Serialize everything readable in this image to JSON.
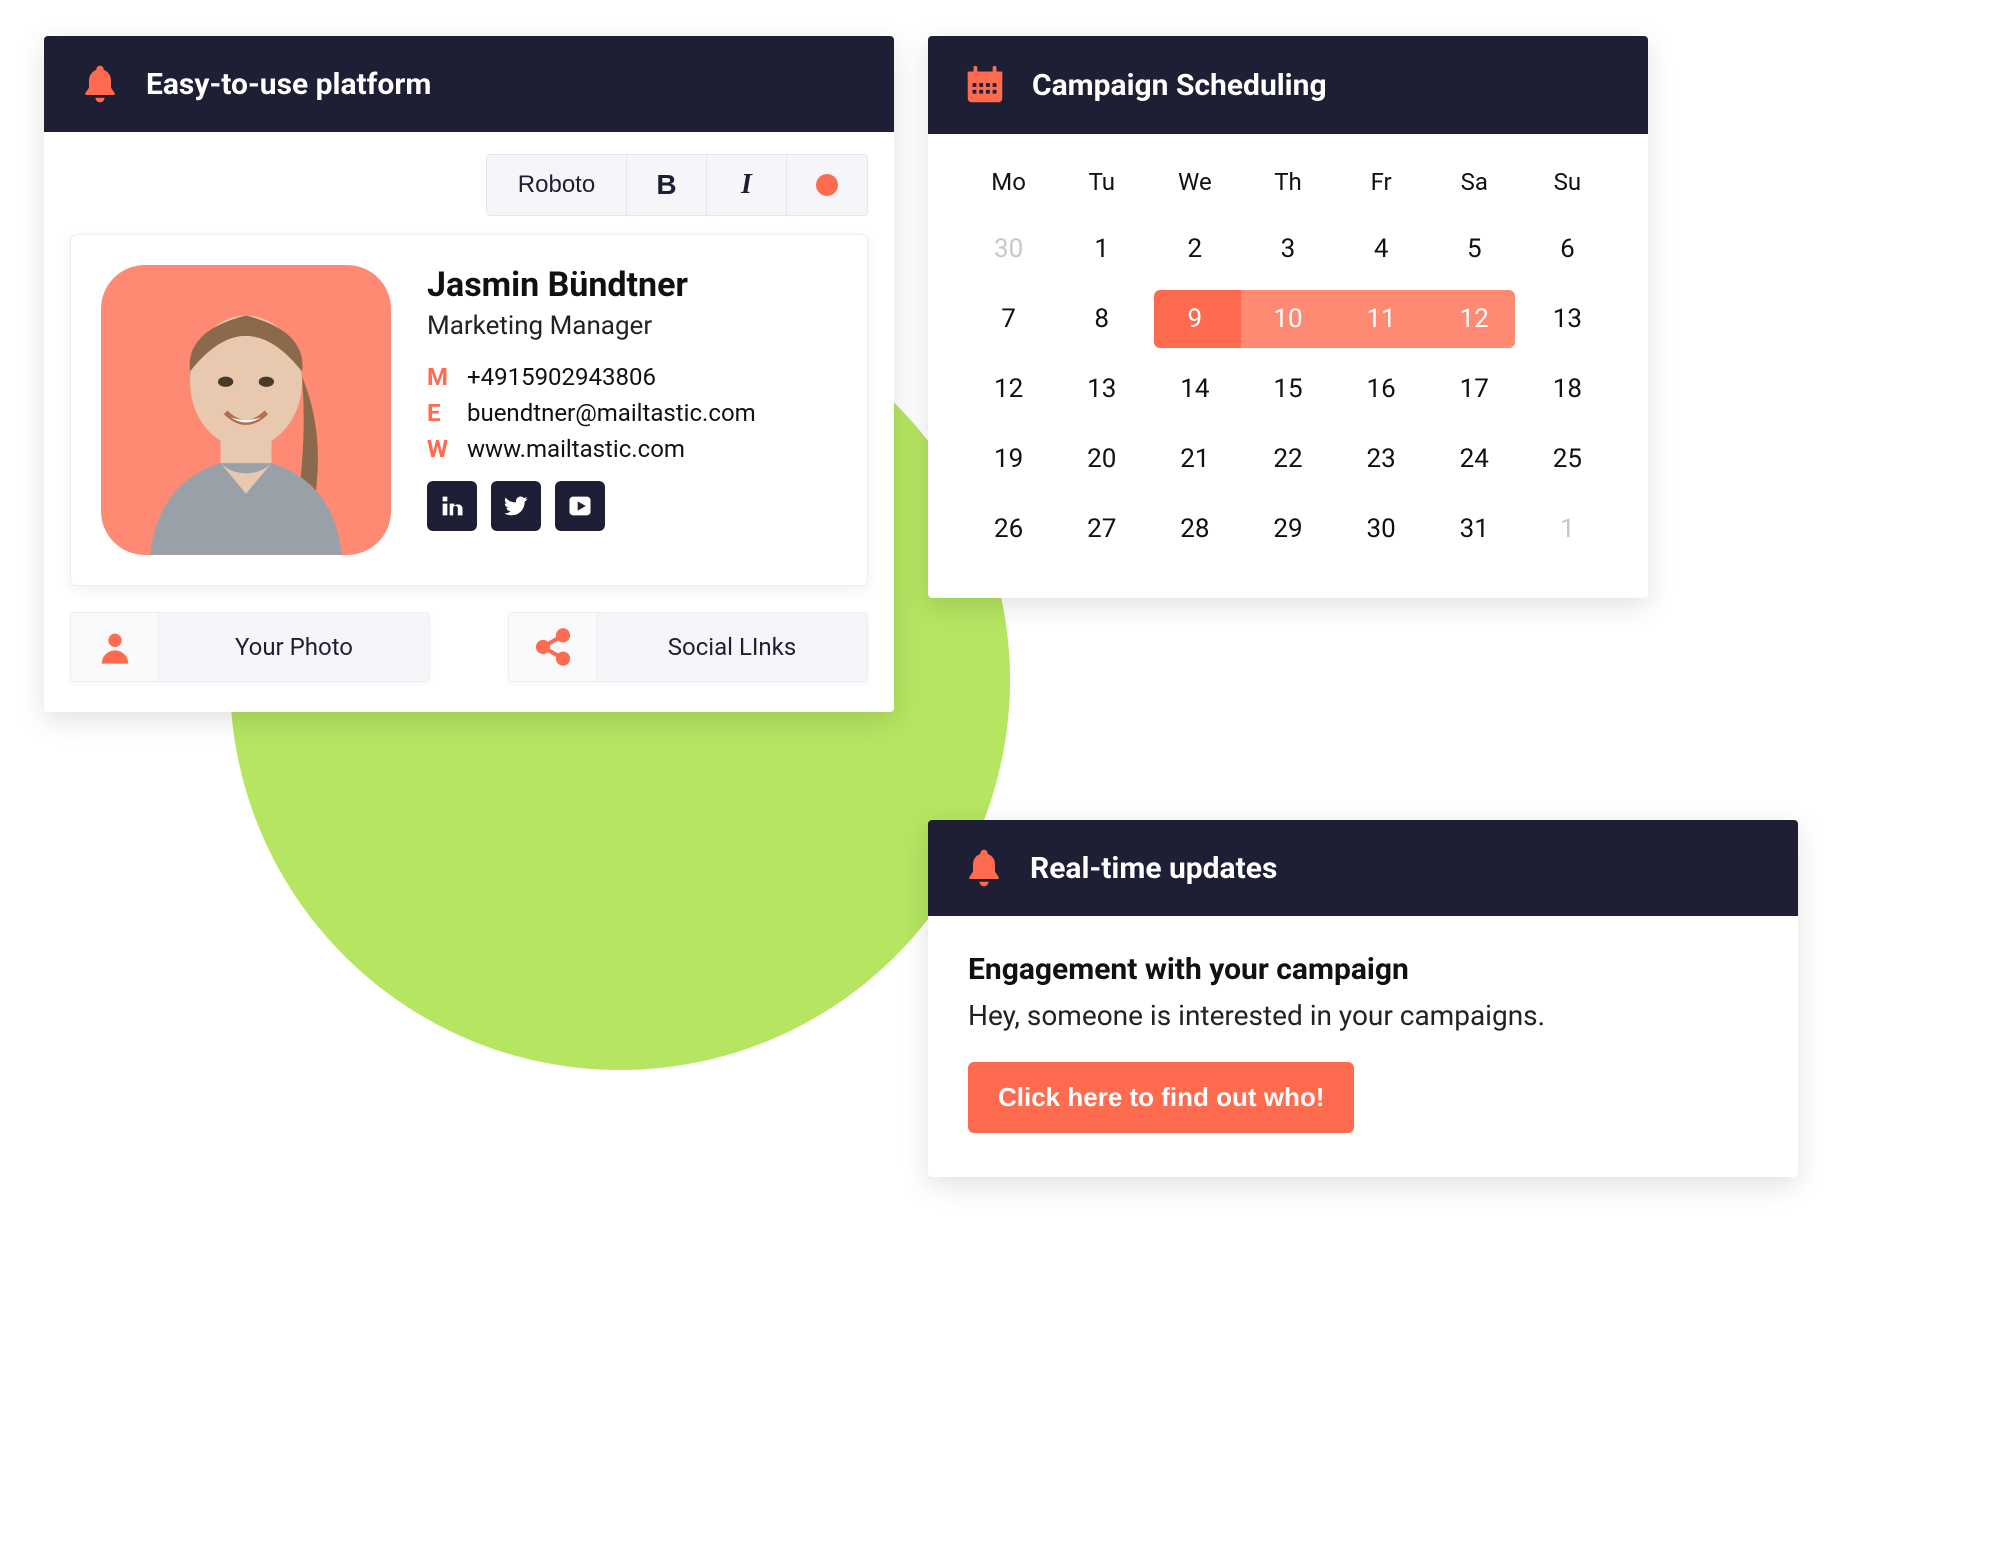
{
  "platform": {
    "title": "Easy-to-use platform",
    "toolbar": {
      "font": "Roboto",
      "bold": "B",
      "italic": "I"
    },
    "signature": {
      "name": "Jasmin Bündtner",
      "role": "Marketing Manager",
      "mobile_label": "M",
      "mobile": "+4915902943806",
      "email_label": "E",
      "email": "buendtner@mailtastic.com",
      "web_label": "W",
      "web": "www.mailtastic.com"
    },
    "buttons": {
      "photo": "Your Photo",
      "social": "Social LInks"
    }
  },
  "calendar": {
    "title": "Campaign Scheduling",
    "weekdays": [
      "Mo",
      "Tu",
      "We",
      "Th",
      "Fr",
      "Sa",
      "Su"
    ],
    "cells": [
      {
        "n": "30",
        "muted": true
      },
      {
        "n": "1"
      },
      {
        "n": "2"
      },
      {
        "n": "3"
      },
      {
        "n": "4"
      },
      {
        "n": "5"
      },
      {
        "n": "6"
      },
      {
        "n": "7"
      },
      {
        "n": "8"
      },
      {
        "n": "9",
        "sel": true,
        "first": true
      },
      {
        "n": "10",
        "sel": true
      },
      {
        "n": "11",
        "sel": true
      },
      {
        "n": "12",
        "sel": true,
        "last": true
      },
      {
        "n": "13"
      },
      {
        "n": "12"
      },
      {
        "n": "13"
      },
      {
        "n": "14"
      },
      {
        "n": "15"
      },
      {
        "n": "16"
      },
      {
        "n": "17"
      },
      {
        "n": "18"
      },
      {
        "n": "19"
      },
      {
        "n": "20"
      },
      {
        "n": "21"
      },
      {
        "n": "22"
      },
      {
        "n": "23"
      },
      {
        "n": "24"
      },
      {
        "n": "25"
      },
      {
        "n": "26"
      },
      {
        "n": "27"
      },
      {
        "n": "28"
      },
      {
        "n": "29"
      },
      {
        "n": "30"
      },
      {
        "n": "31"
      },
      {
        "n": "1",
        "muted": true
      }
    ]
  },
  "updates": {
    "title": "Real-time updates",
    "heading": "Engagement with your campaign",
    "body": "Hey, someone is interested in your campaigns.",
    "cta": "Click here to find out who!"
  }
}
